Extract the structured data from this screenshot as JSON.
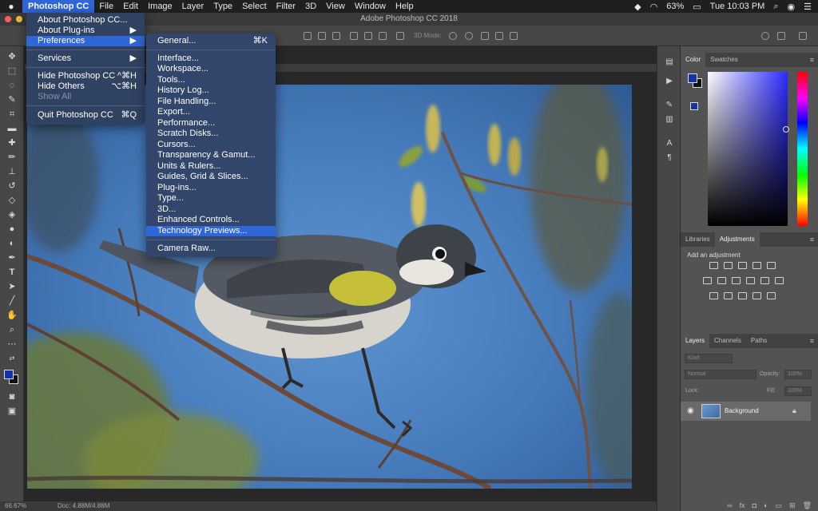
{
  "menubar": {
    "apple": "",
    "items": [
      "Photoshop CC",
      "File",
      "Edit",
      "Image",
      "Layer",
      "Type",
      "Select",
      "Filter",
      "3D",
      "View",
      "Window",
      "Help"
    ],
    "battery": "63%",
    "clock": "Tue 10:03 PM"
  },
  "window": {
    "title": "Adobe Photoshop CC 2018"
  },
  "options_bar": {
    "mode_label": "3D Mode:"
  },
  "app_menu": {
    "items": [
      {
        "label": "About Photoshop CC...",
        "shortcut": ""
      },
      {
        "label": "About Plug-ins",
        "shortcut": "▶"
      },
      {
        "label": "Preferences",
        "shortcut": "▶"
      },
      {
        "label": "Services",
        "shortcut": "▶"
      },
      {
        "label": "Hide Photoshop CC",
        "shortcut": "^⌘H"
      },
      {
        "label": "Hide Others",
        "shortcut": "⌥⌘H"
      },
      {
        "label": "Show All",
        "shortcut": ""
      },
      {
        "label": "Quit Photoshop CC",
        "shortcut": "⌘Q"
      }
    ]
  },
  "preferences_menu": {
    "items": [
      {
        "label": "General...",
        "shortcut": "⌘K"
      },
      {
        "label": "Interface...",
        "shortcut": ""
      },
      {
        "label": "Workspace...",
        "shortcut": ""
      },
      {
        "label": "Tools...",
        "shortcut": ""
      },
      {
        "label": "History Log...",
        "shortcut": ""
      },
      {
        "label": "File Handling...",
        "shortcut": ""
      },
      {
        "label": "Export...",
        "shortcut": ""
      },
      {
        "label": "Performance...",
        "shortcut": ""
      },
      {
        "label": "Scratch Disks...",
        "shortcut": ""
      },
      {
        "label": "Cursors...",
        "shortcut": ""
      },
      {
        "label": "Transparency & Gamut...",
        "shortcut": ""
      },
      {
        "label": "Units & Rulers...",
        "shortcut": ""
      },
      {
        "label": "Guides, Grid & Slices...",
        "shortcut": ""
      },
      {
        "label": "Plug-ins...",
        "shortcut": ""
      },
      {
        "label": "Type...",
        "shortcut": ""
      },
      {
        "label": "3D...",
        "shortcut": ""
      },
      {
        "label": "Enhanced Controls...",
        "shortcut": ""
      },
      {
        "label": "Technology Previews...",
        "shortcut": ""
      },
      {
        "label": "Camera Raw...",
        "shortcut": ""
      }
    ],
    "highlighted": "Technology Previews..."
  },
  "color_panel": {
    "tabs": [
      "Color",
      "Swatches"
    ],
    "fg_color": "#1433a8",
    "bg_color": "#111111"
  },
  "adjustments_panel": {
    "tabs": [
      "Libraries",
      "Adjustments"
    ],
    "add_label": "Add an adjustment"
  },
  "layers_panel": {
    "tabs": [
      "Layers",
      "Channels",
      "Paths"
    ],
    "kind_placeholder": "Kind",
    "blend_mode": "Normal",
    "opacity_label": "Opacity:",
    "opacity_value": "100%",
    "lock_label": "Lock:",
    "fill_label": "Fill:",
    "fill_value": "100%",
    "layer_name": "Background"
  },
  "status": {
    "zoom": "66.67%",
    "doc": "Doc: 4.88M/4.88M"
  },
  "accent_color": "#2f66d8"
}
